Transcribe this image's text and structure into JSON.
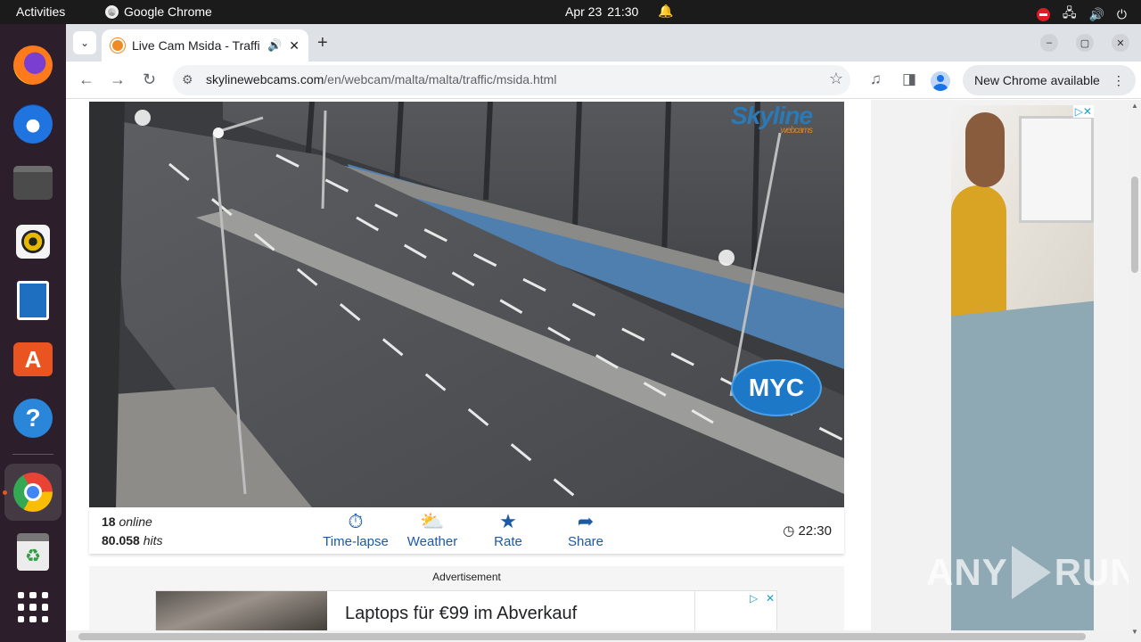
{
  "topbar": {
    "activities": "Activities",
    "app_name": "Google Chrome",
    "date": "Apr 23",
    "time": "21:30"
  },
  "dock": {
    "items": [
      "firefox",
      "thunderbird",
      "files",
      "rhythmbox",
      "libreoffice-impress",
      "app-center",
      "help",
      "chrome",
      "trash",
      "show-apps"
    ]
  },
  "browser": {
    "tab_title": "Live Cam Msida - Traffic",
    "url_domain": "skylinewebcams.com",
    "url_path": "/en/webcam/malta/malta/traffic/msida.html",
    "update_label": "New Chrome available"
  },
  "camera": {
    "logo_main": "Skyline",
    "logo_sub": "webcams",
    "badge_text": "MYC"
  },
  "infobar": {
    "online_count": "18",
    "online_label": "online",
    "hits_count": "80.058",
    "hits_label": "hits",
    "actions": [
      "Time-lapse",
      "Weather",
      "Rate",
      "Share"
    ],
    "local_time": "22:30"
  },
  "advert": {
    "label": "Advertisement",
    "headline": "Laptops für €99 im Abverkauf"
  },
  "watermark": {
    "left": "ANY",
    "right": "RUN"
  },
  "colors": {
    "accent_blue": "#1b5aa5",
    "dock_bg": "#2c1e2b",
    "topbar_bg": "#1b1b1b"
  }
}
